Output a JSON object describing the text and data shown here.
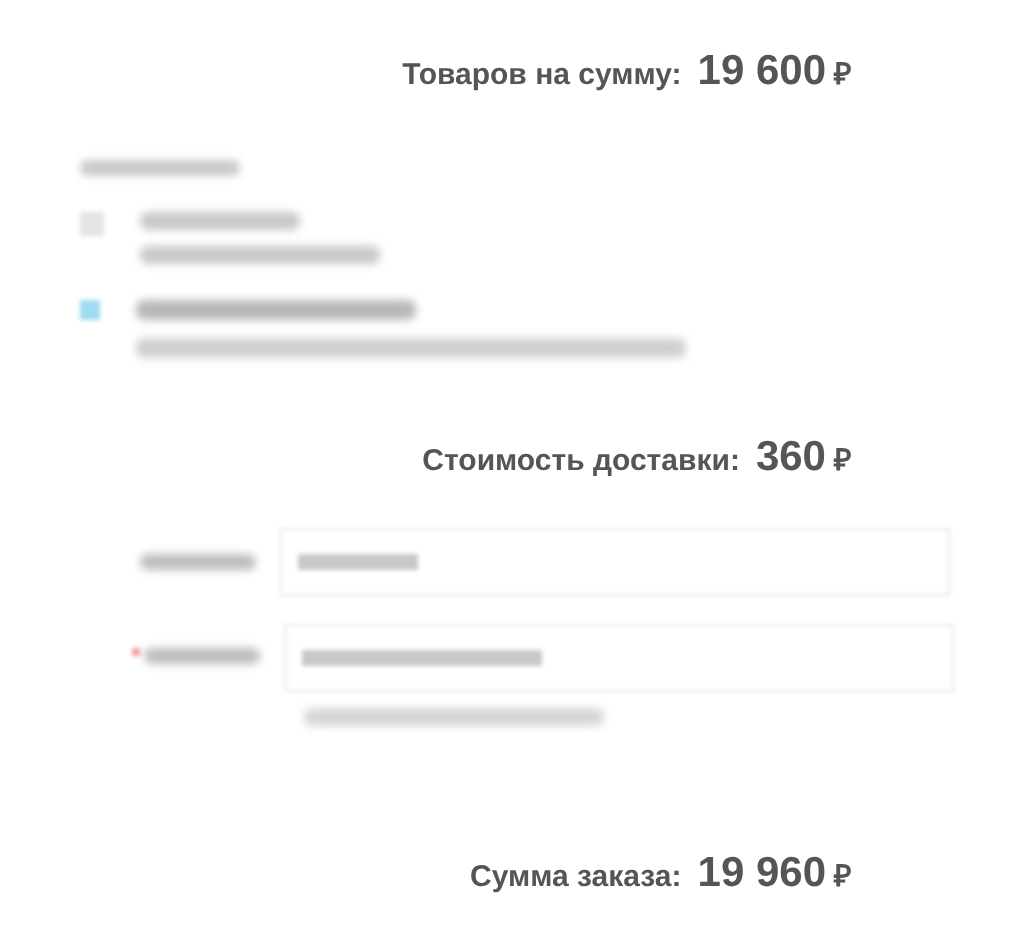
{
  "options": [
    {
      "selected": false
    },
    {
      "selected": true
    }
  ],
  "totals": [
    {
      "label": "Товаров на сумму:",
      "amount": "19 600",
      "currency": "₽"
    },
    {
      "label": "Стоимость доставки:",
      "amount": "360",
      "currency": "₽"
    },
    {
      "label": "Сумма заказа:",
      "amount": "19 960",
      "currency": "₽"
    }
  ]
}
